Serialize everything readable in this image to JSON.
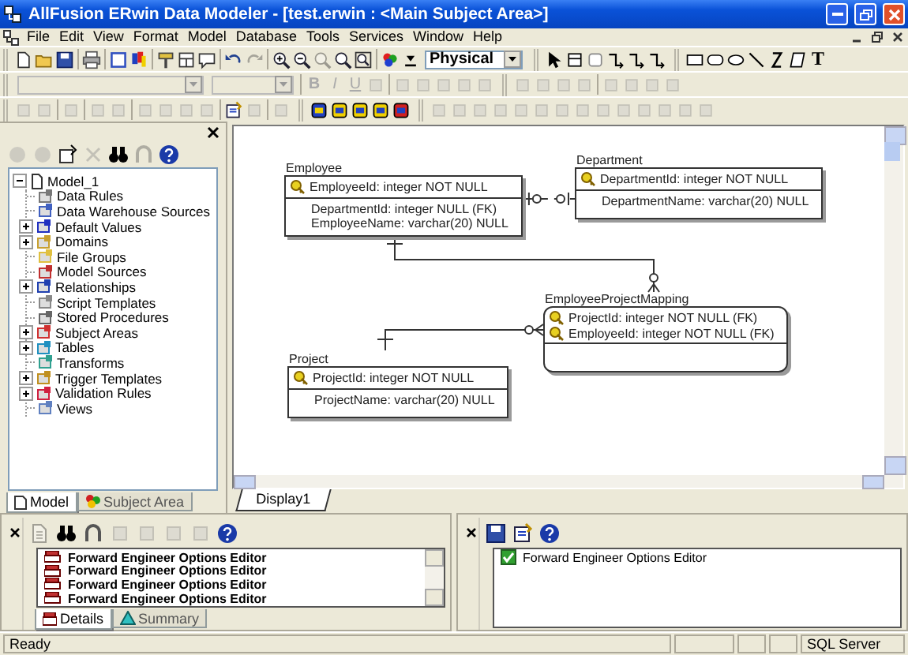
{
  "window": {
    "title": "AllFusion ERwin Data Modeler - [test.erwin : <Main Subject Area>]"
  },
  "menu": [
    "File",
    "Edit",
    "View",
    "Format",
    "Model",
    "Database",
    "Tools",
    "Services",
    "Window",
    "Help"
  ],
  "toolbars": [
    [
      [
        [
          {
            "kind": "new",
            "disabled": false
          },
          {
            "kind": "open",
            "disabled": false
          },
          {
            "kind": "save",
            "disabled": false
          }
        ],
        [
          {
            "kind": "print",
            "disabled": false
          }
        ],
        [
          {
            "kind": "frame",
            "disabled": false
          },
          {
            "kind": "colors",
            "disabled": false
          }
        ],
        [
          {
            "kind": "brush",
            "disabled": false
          },
          {
            "kind": "grid",
            "disabled": false
          },
          {
            "kind": "note",
            "disabled": false
          }
        ],
        [
          {
            "kind": "undo",
            "disabled": false
          },
          {
            "kind": "redo",
            "disabled": true
          }
        ],
        [
          {
            "kind": "zoom-in",
            "disabled": false
          },
          {
            "kind": "zoom-out",
            "disabled": false
          },
          {
            "kind": "zoom",
            "disabled": true
          },
          {
            "kind": "zoom",
            "disabled": false
          },
          {
            "kind": "zoom-fit",
            "disabled": false
          }
        ],
        [
          {
            "kind": "palette",
            "disabled": false
          },
          {
            "kind": "pin",
            "disabled": false
          },
          {
            "kind": "dropdown",
            "value": "Physical",
            "disabled": false
          }
        ]
      ],
      [
        [
          {
            "kind": "pointer",
            "disabled": false
          },
          {
            "kind": "entity",
            "disabled": false
          },
          {
            "kind": "view",
            "disabled": false
          },
          {
            "kind": "rel",
            "disabled": false
          },
          {
            "kind": "rel",
            "disabled": false
          },
          {
            "kind": "rel",
            "disabled": false
          }
        ]
      ],
      [
        [
          {
            "kind": "rect",
            "disabled": false
          },
          {
            "kind": "rrect",
            "disabled": false
          },
          {
            "kind": "ellipse",
            "disabled": false
          },
          {
            "kind": "line",
            "disabled": false
          },
          {
            "kind": "zigzag",
            "disabled": false
          },
          {
            "kind": "shape",
            "disabled": false
          },
          {
            "kind": "letter",
            "label": "T",
            "disabled": false
          }
        ]
      ]
    ],
    [
      [
        [
          {
            "kind": "font-box",
            "disabled": true
          },
          {
            "kind": "size-box",
            "disabled": true
          }
        ],
        [
          {
            "kind": "bold",
            "label": "B",
            "disabled": true
          },
          {
            "kind": "italic",
            "label": "I",
            "disabled": true
          },
          {
            "kind": "underline",
            "label": "U",
            "disabled": true
          },
          {
            "kind": "tool",
            "disabled": true
          }
        ],
        [
          {
            "kind": "tool",
            "disabled": true
          },
          {
            "kind": "tool",
            "disabled": true
          },
          {
            "kind": "tool",
            "disabled": true
          },
          {
            "kind": "tool",
            "disabled": true
          },
          {
            "kind": "tool",
            "disabled": true
          }
        ]
      ],
      [
        [
          {
            "kind": "tool",
            "disabled": true
          },
          {
            "kind": "tool",
            "disabled": true
          },
          {
            "kind": "tool",
            "disabled": true
          },
          {
            "kind": "tool",
            "disabled": true
          }
        ],
        [
          {
            "kind": "tool",
            "disabled": true
          },
          {
            "kind": "tool",
            "disabled": true
          },
          {
            "kind": "tool",
            "disabled": true
          },
          {
            "kind": "tool",
            "disabled": true
          }
        ]
      ]
    ],
    [
      [
        [
          {
            "kind": "tool",
            "disabled": true
          },
          {
            "kind": "tool",
            "disabled": true
          }
        ],
        [
          {
            "kind": "tool",
            "disabled": true
          }
        ],
        [
          {
            "kind": "tool",
            "disabled": true
          },
          {
            "kind": "tool",
            "disabled": true
          }
        ],
        [
          {
            "kind": "tool",
            "disabled": true
          },
          {
            "kind": "tool",
            "disabled": true
          },
          {
            "kind": "tool",
            "disabled": true
          },
          {
            "kind": "tool",
            "disabled": true
          }
        ],
        [
          {
            "kind": "properties",
            "disabled": false
          },
          {
            "kind": "tool",
            "disabled": true
          }
        ],
        [
          {
            "kind": "tool",
            "disabled": true
          }
        ]
      ],
      [
        [
          {
            "kind": "db-blue",
            "disabled": false
          },
          {
            "kind": "db-yellow",
            "disabled": false
          },
          {
            "kind": "db-yellow",
            "disabled": false
          },
          {
            "kind": "db-yellow",
            "disabled": false
          },
          {
            "kind": "db-red",
            "disabled": false
          }
        ]
      ],
      [
        [
          {
            "kind": "tool",
            "disabled": true
          },
          {
            "kind": "tool",
            "disabled": true
          },
          {
            "kind": "tool",
            "disabled": true
          },
          {
            "kind": "tool",
            "disabled": true
          },
          {
            "kind": "tool",
            "disabled": true
          },
          {
            "kind": "tool",
            "disabled": true
          },
          {
            "kind": "tool",
            "disabled": true
          },
          {
            "kind": "tool",
            "disabled": true
          },
          {
            "kind": "tool",
            "disabled": true
          },
          {
            "kind": "tool",
            "disabled": true
          },
          {
            "kind": "tool",
            "disabled": true
          },
          {
            "kind": "tool",
            "disabled": true
          },
          {
            "kind": "tool",
            "disabled": true
          },
          {
            "kind": "tool",
            "disabled": true
          }
        ]
      ]
    ]
  ],
  "model_explorer": {
    "toolbar": [
      {
        "kind": "circle",
        "disabled": true
      },
      {
        "kind": "circle",
        "disabled": true
      },
      {
        "kind": "new-item",
        "disabled": false
      },
      {
        "kind": "delete",
        "disabled": true
      },
      {
        "kind": "binoculars",
        "disabled": false
      },
      {
        "kind": "find-next",
        "disabled": true
      },
      {
        "kind": "help",
        "disabled": false
      }
    ],
    "tree": [
      {
        "label": "Model_1",
        "expanded": true,
        "children": [
          {
            "label": "Data Rules"
          },
          {
            "label": "Data Warehouse Sources"
          },
          {
            "label": "Default Values",
            "expanded": false
          },
          {
            "label": "Domains",
            "expanded": false
          },
          {
            "label": "File Groups"
          },
          {
            "label": "Model Sources"
          },
          {
            "label": "Relationships",
            "expanded": false
          },
          {
            "label": "Script Templates"
          },
          {
            "label": "Stored Procedures"
          },
          {
            "label": "Subject Areas",
            "expanded": false
          },
          {
            "label": "Tables",
            "expanded": false
          },
          {
            "label": "Transforms"
          },
          {
            "label": "Trigger Templates",
            "expanded": false
          },
          {
            "label": "Validation Rules",
            "expanded": false
          },
          {
            "label": "Views"
          }
        ]
      }
    ],
    "tabs": [
      {
        "label": "Model",
        "selected": true
      },
      {
        "label": "Subject Area",
        "selected": false
      }
    ]
  },
  "diagram": {
    "entities": [
      {
        "name": "Employee",
        "kind": "independent",
        "keys": [
          "EmployeeId: integer NOT NULL"
        ],
        "attributes": [
          "DepartmentId: integer NULL (FK)",
          "EmployeeName: varchar(20) NULL"
        ]
      },
      {
        "name": "Department",
        "kind": "independent",
        "keys": [
          "DepartmentId: integer NOT NULL"
        ],
        "attributes": [
          "DepartmentName: varchar(20) NULL"
        ]
      },
      {
        "name": "EmployeeProjectMapping",
        "kind": "dependent",
        "keys": [
          "ProjectId: integer NOT NULL (FK)",
          "EmployeeId: integer NOT NULL (FK)"
        ]
      },
      {
        "name": "Project",
        "kind": "independent",
        "keys": [
          "ProjectId: integer NOT NULL"
        ],
        "attributes": [
          "ProjectName: varchar(20) NULL"
        ]
      }
    ],
    "relationships": [
      {
        "kind": "non-identifying"
      },
      {
        "kind": "identifying"
      },
      {
        "kind": "identifying"
      }
    ],
    "tabs": [
      {
        "label": "Display1",
        "selected": true
      }
    ]
  },
  "action_log": {
    "toolbar": [
      {
        "kind": "doc",
        "disabled": true
      },
      {
        "kind": "binoculars",
        "disabled": false
      },
      {
        "kind": "find-next",
        "disabled": false
      },
      {
        "kind": "tool",
        "disabled": true
      },
      {
        "kind": "tool",
        "disabled": true
      },
      {
        "kind": "tool",
        "disabled": true
      },
      {
        "kind": "tool",
        "disabled": true
      },
      {
        "kind": "help",
        "disabled": false
      }
    ],
    "items": [
      "Forward Engineer Options Editor",
      "Forward Engineer Options Editor",
      "Forward Engineer Options Editor",
      "Forward Engineer Options Editor"
    ],
    "tabs": [
      {
        "label": "Details",
        "selected": true
      },
      {
        "label": "Summary",
        "selected": false
      }
    ]
  },
  "validation": {
    "toolbar": [
      {
        "kind": "save",
        "disabled": false
      },
      {
        "kind": "properties",
        "disabled": false
      },
      {
        "kind": "help",
        "disabled": false
      }
    ],
    "items": [
      {
        "label": "Forward Engineer Options Editor",
        "checked": true
      }
    ]
  },
  "status_bar": [
    "Ready",
    "SQL Server"
  ]
}
